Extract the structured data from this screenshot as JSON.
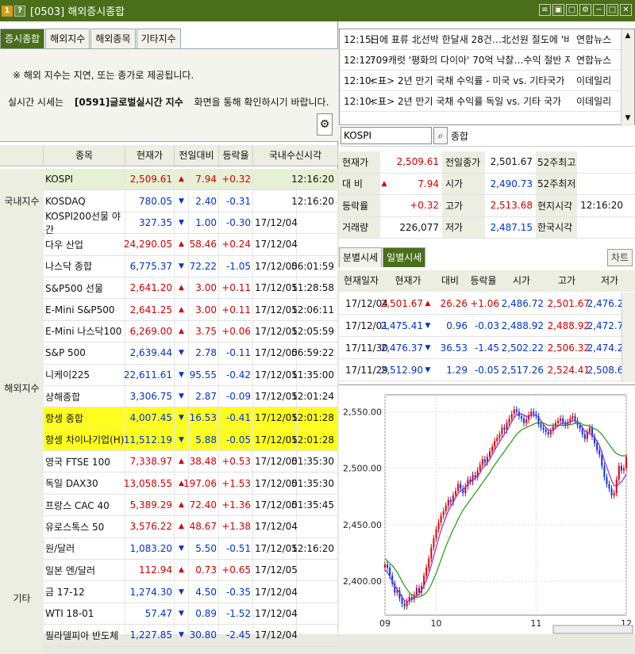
{
  "window": {
    "title": "[0503] 해외증시종합",
    "icon1": "1",
    "icon2": "?"
  },
  "tabs": [
    {
      "label": "증시종합"
    },
    {
      "label": "해외지수"
    },
    {
      "label": "해외종목"
    },
    {
      "label": "기타지수"
    }
  ],
  "notice": {
    "line1": "※ 해외 지수는 지연, 또는 종가로 제공됩니다.",
    "line2_a": "실시간 시세는",
    "line2_b": "[0591]글로벌실시간 지수",
    "line2_c": "화면을 통해 확인하시기 바랍니다."
  },
  "grid": {
    "headers": [
      "종목",
      "현재가",
      "전일대비",
      "등락율",
      "국내수신시각"
    ],
    "categories": [
      "국내지수",
      "해외지수",
      "기타"
    ],
    "rows": [
      {
        "name": "KOSPI",
        "price": "2,509.61",
        "dir": "up",
        "change": "7.94",
        "rate": "+0.32",
        "date": "",
        "time": "12:16:20"
      },
      {
        "name": "KOSDAQ",
        "price": "780.05",
        "dir": "down",
        "change": "2.40",
        "rate": "-0.31",
        "date": "",
        "time": "12:16:20"
      },
      {
        "name": "KOSPI200선물 야간",
        "price": "327.35",
        "dir": "down",
        "change": "1.00",
        "rate": "-0.30",
        "date": "17/12/04",
        "time": ""
      },
      {
        "name": "다우 산업",
        "price": "24,290.05",
        "dir": "up",
        "change": "58.46",
        "rate": "+0.24",
        "date": "17/12/04",
        "time": ""
      },
      {
        "name": "나스닥 종합",
        "price": "6,775.37",
        "dir": "down",
        "change": "72.22",
        "rate": "-1.05",
        "date": "17/12/05",
        "time": "06:01:59"
      },
      {
        "name": "S&P500 선물",
        "price": "2,641.20",
        "dir": "up",
        "change": "3.00",
        "rate": "+0.11",
        "date": "17/12/05",
        "time": "11:28:58"
      },
      {
        "name": "E-Mini S&P500",
        "price": "2,641.25",
        "dir": "up",
        "change": "3.00",
        "rate": "+0.11",
        "date": "17/12/05",
        "time": "12:06:11"
      },
      {
        "name": "E-Mini 나스닥100",
        "price": "6,269.00",
        "dir": "up",
        "change": "3.75",
        "rate": "+0.06",
        "date": "17/12/05",
        "time": "12:05:59"
      },
      {
        "name": "S&P 500",
        "price": "2,639.44",
        "dir": "down",
        "change": "2.78",
        "rate": "-0.11",
        "date": "17/12/05",
        "time": "06:59:22"
      },
      {
        "name": "니케이225",
        "price": "22,611.61",
        "dir": "down",
        "change": "95.55",
        "rate": "-0.42",
        "date": "17/12/05",
        "time": "11:35:00"
      },
      {
        "name": "상해종합",
        "price": "3,306.75",
        "dir": "down",
        "change": "2.87",
        "rate": "-0.09",
        "date": "17/12/05",
        "time": "12:01:24"
      },
      {
        "name": "항셍 종합",
        "price": "4,007.45",
        "dir": "down",
        "change": "16.53",
        "rate": "-0.41",
        "date": "17/12/05",
        "time": "12:01:28"
      },
      {
        "name": "항셍 차이나기업(H)",
        "price": "11,512.19",
        "dir": "down",
        "change": "5.88",
        "rate": "-0.05",
        "date": "17/12/05",
        "time": "12:01:28"
      },
      {
        "name": "영국 FTSE 100",
        "price": "7,338.97",
        "dir": "up",
        "change": "38.48",
        "rate": "+0.53",
        "date": "17/12/05",
        "time": "01:35:30"
      },
      {
        "name": "독일 DAX30",
        "price": "13,058.55",
        "dir": "up",
        "change": "197.06",
        "rate": "+1.53",
        "date": "17/12/05",
        "time": "01:35:30"
      },
      {
        "name": "프랑스 CAC 40",
        "price": "5,389.29",
        "dir": "up",
        "change": "72.40",
        "rate": "+1.36",
        "date": "17/12/05",
        "time": "01:35:45"
      },
      {
        "name": "유로스톡스 50",
        "price": "3,576.22",
        "dir": "up",
        "change": "48.67",
        "rate": "+1.38",
        "date": "17/12/04",
        "time": ""
      },
      {
        "name": "원/달러",
        "price": "1,083.20",
        "dir": "down",
        "change": "5.50",
        "rate": "-0.51",
        "date": "17/12/05",
        "time": "12:16:20"
      },
      {
        "name": "일본 엔/달러",
        "price": "112.94",
        "dir": "up",
        "change": "0.73",
        "rate": "+0.65",
        "date": "17/12/05",
        "time": ""
      },
      {
        "name": "금 17-12",
        "price": "1,274.30",
        "dir": "down",
        "change": "4.50",
        "rate": "-0.35",
        "date": "17/12/04",
        "time": ""
      },
      {
        "name": "WTI 18-01",
        "price": "57.47",
        "dir": "down",
        "change": "0.89",
        "rate": "-1.52",
        "date": "17/12/04",
        "time": ""
      },
      {
        "name": "필라델피아 반도체",
        "price": "1,227.85",
        "dir": "down",
        "change": "30.80",
        "rate": "-2.45",
        "date": "17/12/04",
        "time": ""
      }
    ]
  },
  "news": [
    {
      "time": "12:15:",
      "title": "日에 표류 北선박 한달새 28건…北선원 절도에 '비난",
      "source": "연합뉴스"
    },
    {
      "time": "12:12:",
      "title": "709캐럿 '평화의 다이아' 70억 낙찰…수익 절반 지역사",
      "source": "연합뉴스"
    },
    {
      "time": "12:10:",
      "title": "<표> 2년 만기 국채 수익률 - 미국 vs. 기타국가",
      "source": "이데일리"
    },
    {
      "time": "12:10:",
      "title": "<표> 2년 만기 국채 수익률 독일 vs. 기타 국가",
      "source": "이데일리"
    }
  ],
  "search": {
    "value": "KOSPI",
    "name": "종합"
  },
  "quote": {
    "rows": [
      {
        "l1": "현재가",
        "v1": "2,509.61",
        "v1color": "red",
        "arrow": "",
        "l2": "전일종가",
        "v2": "2,501.67",
        "v2color": "black",
        "l3": "52주최고",
        "v3": ""
      },
      {
        "l1": "대 비",
        "v1": "7.94",
        "v1color": "red",
        "arrow": "up",
        "l2": "시가",
        "v2": "2,490.73",
        "v2color": "blue",
        "l3": "52주최저",
        "v3": ""
      },
      {
        "l1": "등락률",
        "v1": "+0.32",
        "v1color": "red",
        "arrow": "",
        "l2": "고가",
        "v2": "2,513.68",
        "v2color": "red",
        "l3": "현지시각",
        "v3": "12:16:20"
      },
      {
        "l1": "거래량",
        "v1": "226,077",
        "v1color": "black",
        "arrow": "",
        "l2": "저가",
        "v2": "2,487.15",
        "v2color": "blue",
        "l3": "한국시각",
        "v3": ""
      }
    ]
  },
  "tabs2": [
    {
      "label": "분별시세"
    },
    {
      "label": "일별시세"
    }
  ],
  "chart_button": "차트",
  "daily": {
    "headers": [
      "현재일자",
      "현재가",
      "대비",
      "등락율",
      "시가",
      "고가",
      "저가"
    ],
    "rows": [
      {
        "date": "17/12/04",
        "price": "2,501.67",
        "dir": "up",
        "change": "26.26",
        "rate": "+1.06",
        "open": "2,486.72",
        "high": "2,501.67",
        "low": "2,476.29"
      },
      {
        "date": "17/12/01",
        "price": "2,475.41",
        "dir": "down",
        "change": "0.96",
        "rate": "-0.03",
        "open": "2,488.92",
        "high": "2,488.92",
        "low": "2,472.75"
      },
      {
        "date": "17/11/30",
        "price": "2,476.37",
        "dir": "down",
        "change": "36.53",
        "rate": "-1.45",
        "open": "2,502.22",
        "high": "2,506.32",
        "low": "2,474.28"
      },
      {
        "date": "17/11/29",
        "price": "2,512.90",
        "dir": "down",
        "change": "1.29",
        "rate": "-0.05",
        "open": "2,517.26",
        "high": "2,524.41",
        "low": "2,508.66"
      }
    ]
  },
  "chart_data": {
    "type": "line",
    "title": "",
    "yticks": [
      2400,
      2450,
      2500,
      2550
    ],
    "ytick_labels": [
      "2,400.00",
      "2,450.00",
      "2,500.00",
      "2,550.00"
    ],
    "ylim": [
      2370,
      2565
    ],
    "xtick_labels": [
      "09",
      "10",
      "11",
      "12"
    ],
    "xtick_index": [
      0,
      21,
      62,
      99
    ],
    "series": [
      {
        "color": "#d40000",
        "values": [
          2415,
          2412,
          2405,
          2398,
          2390,
          2392,
          2385,
          2380,
          2378,
          2382,
          2386,
          2384,
          2388,
          2394,
          2390,
          2396,
          2405,
          2412,
          2420,
          2430,
          2438,
          2446,
          2452,
          2458,
          2462,
          2467,
          2472,
          2470,
          2476,
          2480,
          2486,
          2482,
          2478,
          2484,
          2490,
          2488,
          2494,
          2492,
          2498,
          2503,
          2508,
          2505,
          2510,
          2515,
          2519,
          2524,
          2527,
          2530,
          2536,
          2534,
          2540,
          2544,
          2548,
          2552,
          2550,
          2546,
          2544,
          2540,
          2543,
          2547,
          2550,
          2548,
          2546,
          2539,
          2536,
          2534,
          2532,
          2530,
          2533,
          2537,
          2540,
          2542,
          2544,
          2540,
          2538,
          2541,
          2544,
          2546,
          2542,
          2538,
          2535,
          2530,
          2526,
          2532,
          2536,
          2528,
          2522,
          2516,
          2512,
          2502,
          2492,
          2486,
          2482,
          2476,
          2478,
          2490,
          2502,
          2498,
          2500,
          2510
        ]
      },
      {
        "color": "#8a2be2",
        "values": [
          2410,
          2408,
          2404,
          2400,
          2396,
          2393,
          2390,
          2386,
          2383,
          2382,
          2383,
          2384,
          2385,
          2387,
          2389,
          2392,
          2396,
          2401,
          2407,
          2414,
          2422,
          2430,
          2438,
          2445,
          2451,
          2457,
          2462,
          2466,
          2470,
          2474,
          2478,
          2480,
          2481,
          2483,
          2486,
          2488,
          2490,
          2491,
          2493,
          2496,
          2500,
          2502,
          2505,
          2508,
          2512,
          2516,
          2520,
          2523,
          2527,
          2530,
          2533,
          2537,
          2541,
          2545,
          2547,
          2548,
          2548,
          2547,
          2546,
          2546,
          2547,
          2547,
          2547,
          2545,
          2542,
          2539,
          2536,
          2534,
          2533,
          2534,
          2536,
          2537,
          2539,
          2540,
          2540,
          2540,
          2541,
          2542,
          2542,
          2541,
          2539,
          2536,
          2533,
          2532,
          2531,
          2530,
          2527,
          2524,
          2520,
          2514,
          2507,
          2501,
          2495,
          2489,
          2485,
          2484,
          2486,
          2488,
          2491,
          2495
        ]
      },
      {
        "color": "#1a9a1a",
        "values": [
          2420,
          2418,
          2416,
          2414,
          2411,
          2408,
          2404,
          2400,
          2396,
          2393,
          2390,
          2388,
          2387,
          2386,
          2386,
          2387,
          2388,
          2390,
          2393,
          2397,
          2402,
          2407,
          2413,
          2419,
          2425,
          2431,
          2436,
          2441,
          2446,
          2450,
          2455,
          2459,
          2463,
          2466,
          2469,
          2472,
          2475,
          2478,
          2481,
          2484,
          2487,
          2490,
          2493,
          2496,
          2500,
          2503,
          2506,
          2509,
          2512,
          2515,
          2518,
          2521,
          2524,
          2527,
          2530,
          2532,
          2534,
          2535,
          2536,
          2537,
          2538,
          2539,
          2540,
          2540,
          2540,
          2540,
          2539,
          2538,
          2538,
          2538,
          2538,
          2538,
          2538,
          2538,
          2538,
          2538,
          2539,
          2539,
          2540,
          2540,
          2540,
          2539,
          2538,
          2538,
          2537,
          2536,
          2535,
          2534,
          2532,
          2530,
          2527,
          2524,
          2521,
          2518,
          2515,
          2513,
          2512,
          2511,
          2511,
          2511
        ]
      }
    ]
  }
}
